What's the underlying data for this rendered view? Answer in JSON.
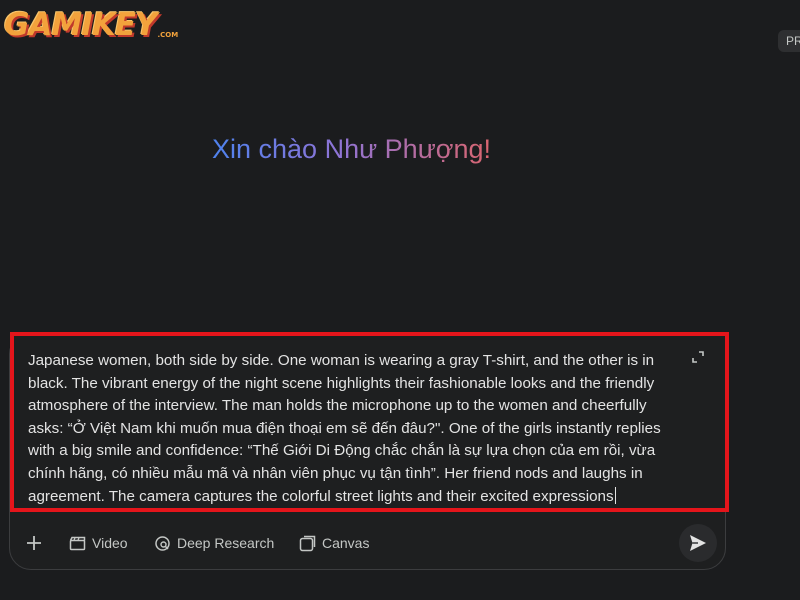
{
  "brand": {
    "logo_text": "GAMIKEY",
    "logo_suffix": ".COM"
  },
  "corner": {
    "label": "PR"
  },
  "greeting": {
    "text": "Xin chào Như Phượng!"
  },
  "prompt": {
    "text": "Japanese women, both side by side. One woman is wearing a gray T-shirt, and the other is in black. The vibrant energy of the night scene highlights their fashionable looks and the friendly atmosphere of the interview. The man holds the microphone up to the women and cheerfully asks: “Ở Việt Nam khi muốn mua điện thoại em sẽ đến đâu?\". One of the girls instantly replies with a big smile and confidence: “Thế Giới Di Động chắc chắn là sự lựa chọn của em rồi, vừa chính hãng, có nhiều mẫu mã và nhân viên phục vụ tận tình”. Her friend nods and laughs in agreement. The camera captures the colorful street lights and their excited expressions"
  },
  "toolbar": {
    "plus_label": "+",
    "video_label": "Video",
    "deep_research_label": "Deep Research",
    "canvas_label": "Canvas"
  },
  "icons": {
    "add": "plus-icon",
    "video": "clapperboard-icon",
    "deep_research": "research-icon",
    "canvas": "canvas-icon",
    "send": "send-icon",
    "expand": "expand-icon"
  },
  "colors": {
    "background": "#1b1c1e",
    "text": "#e3e3e3",
    "muted": "#c4c7c5",
    "highlight_border": "#e4151b",
    "logo": "#f2a23c"
  }
}
